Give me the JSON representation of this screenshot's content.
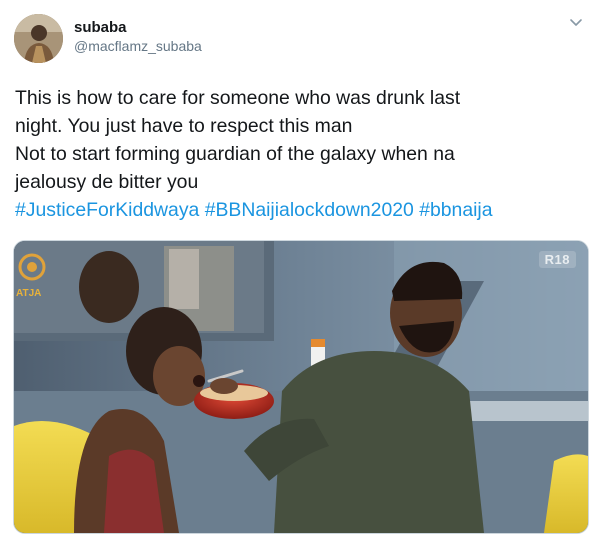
{
  "tweet": {
    "user": {
      "display_name": "subaba",
      "handle": "@macflamz_subaba"
    },
    "menu_icon": "chevron-down-icon",
    "text_lines": [
      "This is how to care for someone who was drunk last",
      "night. You just have to respect this man",
      "Not to start forming guardian of the galaxy when na",
      "jealousy de bitter you"
    ],
    "hashtags": [
      "#JusticeForKiddwaya",
      "#BBNaijialockdown2020",
      "#bbnaija"
    ],
    "media": {
      "rating_badge": "R18",
      "logo_text": "ATJA"
    },
    "colors": {
      "link": "#1b95e0",
      "handle": "#657786",
      "text": "#14171a"
    }
  }
}
